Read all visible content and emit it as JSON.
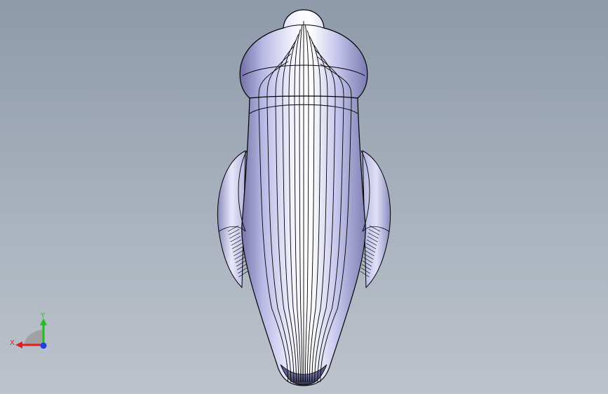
{
  "viewport": {
    "background_top": "#8e9aaa",
    "background_bottom": "#bdc3cb"
  },
  "model": {
    "shading_color": "#c6c6f0",
    "edge_color": "#000000"
  },
  "triad": {
    "x_label": "X",
    "y_label": "Y",
    "x_color": "#e02020",
    "y_color": "#20c020",
    "z_color": "#2040e0"
  }
}
